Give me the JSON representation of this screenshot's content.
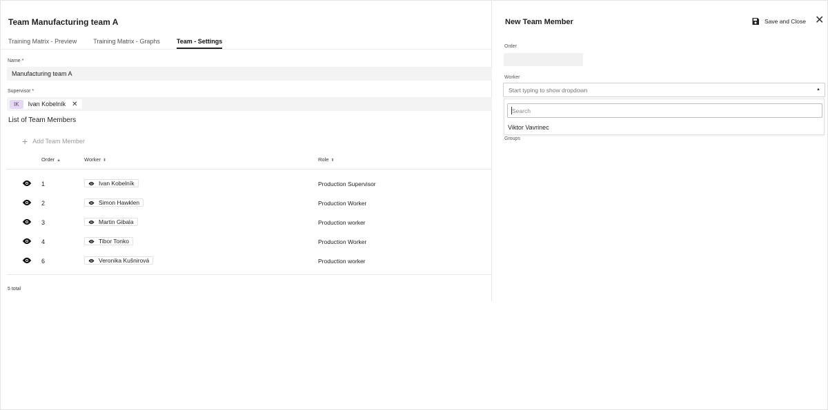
{
  "page": {
    "title": "Team Manufacturing team A",
    "tabs": [
      {
        "label": "Training Matrix - Preview",
        "active": false
      },
      {
        "label": "Training Matrix - Graphs",
        "active": false
      },
      {
        "label": "Team - Settings",
        "active": true
      }
    ]
  },
  "form": {
    "name_label": "Name *",
    "name_value": "Manufacturing team A",
    "supervisor_label": "Supervisor *",
    "supervisor": {
      "initials": "IK",
      "name": "Ivan Kobelník",
      "remove_icon": "close-icon"
    }
  },
  "members": {
    "section_title": "List of Team Members",
    "add_label": "Add Team Member",
    "columns": {
      "order": "Order",
      "worker": "Worker",
      "role": "Role"
    },
    "rows": [
      {
        "order": "1",
        "worker": "Ivan Kobelník",
        "role": "Production Supervisor"
      },
      {
        "order": "2",
        "worker": "Simon Hawklen",
        "role": "Production Worker"
      },
      {
        "order": "3",
        "worker": "Martin Gibala",
        "role": "Production worker"
      },
      {
        "order": "4",
        "worker": "Tibor Tonko",
        "role": "Production Worker"
      },
      {
        "order": "6",
        "worker": "Veronika Kušnirová",
        "role": "Production worker"
      }
    ],
    "total": "5 total"
  },
  "panel": {
    "title": "New Team Member",
    "save_label": "Save and Close",
    "order_label": "Order",
    "worker_label": "Worker",
    "worker_placeholder": "Start typing to show dropdown",
    "search_placeholder": "Search",
    "options": [
      "Viktor Vavrinec"
    ],
    "groups_label": "Groups"
  },
  "colors": {
    "accent": "#222222",
    "chip_bg": "#e4d8f2",
    "field_bg": "#f3f3f3"
  }
}
